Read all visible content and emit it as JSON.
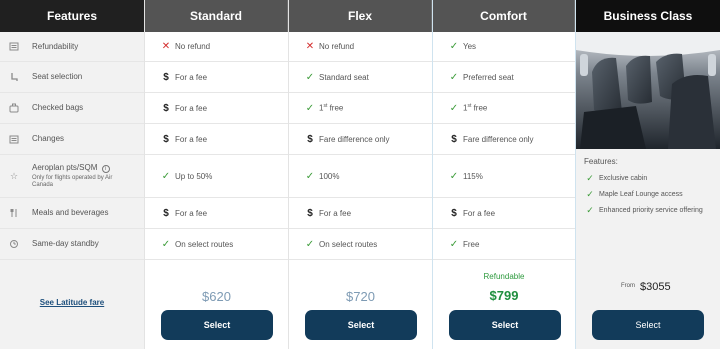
{
  "features": {
    "header": "Features",
    "rows": [
      {
        "icon": "refund-icon",
        "label": "Refundability"
      },
      {
        "icon": "seat-icon",
        "label": "Seat selection"
      },
      {
        "icon": "bag-icon",
        "label": "Checked bags"
      },
      {
        "icon": "changes-icon",
        "label": "Changes"
      },
      {
        "icon": "star-icon",
        "label": "Aeroplan pts/SQM",
        "sub": "Only for flights operated by Air Canada"
      },
      {
        "icon": "meal-icon",
        "label": "Meals and beverages"
      },
      {
        "icon": "standby-icon",
        "label": "Same-day standby"
      }
    ],
    "latitude_link": "See Latitude fare"
  },
  "fares": [
    {
      "name": "Standard",
      "rows": [
        {
          "mark": "cross",
          "text": "No refund"
        },
        {
          "mark": "dollar",
          "text": "For a fee"
        },
        {
          "mark": "dollar",
          "text": "For a fee"
        },
        {
          "mark": "dollar",
          "text": "For a fee"
        },
        {
          "mark": "check",
          "text": "Up to 50%"
        },
        {
          "mark": "dollar",
          "text": "For a fee"
        },
        {
          "mark": "check",
          "text": "On select routes"
        }
      ],
      "price": "$620",
      "select_label": "Select"
    },
    {
      "name": "Flex",
      "rows": [
        {
          "mark": "cross",
          "text": "No refund"
        },
        {
          "mark": "check",
          "text": "Standard seat"
        },
        {
          "mark": "check",
          "text": "1st free"
        },
        {
          "mark": "dollar",
          "text": "Fare difference only"
        },
        {
          "mark": "check",
          "text": "100%"
        },
        {
          "mark": "dollar",
          "text": "For a fee"
        },
        {
          "mark": "check",
          "text": "On select routes"
        }
      ],
      "price": "$720",
      "select_label": "Select"
    },
    {
      "name": "Comfort",
      "rows": [
        {
          "mark": "check",
          "text": "Yes"
        },
        {
          "mark": "check",
          "text": "Preferred seat"
        },
        {
          "mark": "check",
          "text": "1st free"
        },
        {
          "mark": "dollar",
          "text": "Fare difference only"
        },
        {
          "mark": "check",
          "text": "115%"
        },
        {
          "mark": "dollar",
          "text": "For a fee"
        },
        {
          "mark": "check",
          "text": "Free"
        }
      ],
      "refundable": "Refundable",
      "price": "$799",
      "select_label": "Select"
    }
  ],
  "business": {
    "name": "Business Class",
    "features_label": "Features:",
    "features": [
      "Exclusive cabin",
      "Maple Leaf Lounge access",
      "Enhanced priority service offering"
    ],
    "from_label": "From",
    "price": "$3055",
    "select_label": "Select"
  },
  "colors": {
    "check": "#3d9c3a",
    "cross": "#d32c2c",
    "button": "#123b5a",
    "comfort_price": "#1f8f3e",
    "muted_price": "#7e9bb4"
  }
}
